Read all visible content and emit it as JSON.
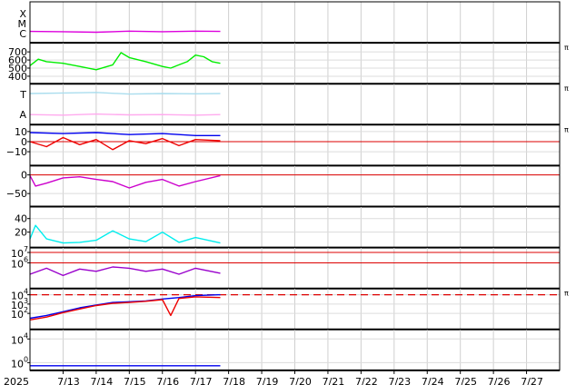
{
  "chart_data": {
    "type": "line",
    "x_start": "2025-07-12",
    "x_end": "2025-07-28",
    "x_ticks": [
      {
        "date": "2025-07-13",
        "label": "7/13"
      },
      {
        "date": "2025-07-14",
        "label": "7/14"
      },
      {
        "date": "2025-07-15",
        "label": "7/15"
      },
      {
        "date": "2025-07-16",
        "label": "7/16"
      },
      {
        "date": "2025-07-17",
        "label": "7/17"
      },
      {
        "date": "2025-07-18",
        "label": "7/18"
      },
      {
        "date": "2025-07-19",
        "label": "7/19"
      },
      {
        "date": "2025-07-20",
        "label": "7/20"
      },
      {
        "date": "2025-07-21",
        "label": "7/21"
      },
      {
        "date": "2025-07-22",
        "label": "7/22"
      },
      {
        "date": "2025-07-23",
        "label": "7/23"
      },
      {
        "date": "2025-07-24",
        "label": "7/24"
      },
      {
        "date": "2025-07-25",
        "label": "7/25"
      },
      {
        "date": "2025-07-26",
        "label": "7/26"
      },
      {
        "date": "2025-07-27",
        "label": "7/27"
      }
    ],
    "year_label": "2025",
    "data_end": "2025-07-17T18:00",
    "grid": true,
    "panels": [
      {
        "id": "xray-class",
        "yscale": "category",
        "categories": [
          "X",
          "M",
          "C"
        ],
        "series": [
          {
            "color": "#dd00dd",
            "level": "C",
            "points": [
              [
                "2025-07-12",
                0.1
              ],
              [
                "2025-07-13",
                0.15
              ],
              [
                "2025-07-14",
                0.25
              ],
              [
                "2025-07-15",
                0.05
              ],
              [
                "2025-07-16",
                0.15
              ],
              [
                "2025-07-17",
                0.05
              ],
              [
                "2025-07-17T18:00",
                0.1
              ]
            ]
          }
        ],
        "right_marker": ""
      },
      {
        "id": "solar-wind-speed",
        "yscale": "linear",
        "ylim": [
          330,
          790
        ],
        "ticks": [
          {
            "v": 400,
            "label": "400"
          },
          {
            "v": 500,
            "label": "500"
          },
          {
            "v": 600,
            "label": "600"
          },
          {
            "v": 700,
            "label": "700"
          }
        ],
        "series": [
          {
            "color": "#00ee00",
            "points": [
              [
                "2025-07-12",
                530
              ],
              [
                "2025-07-12T06:00",
                610
              ],
              [
                "2025-07-12T12:00",
                580
              ],
              [
                "2025-07-13",
                560
              ],
              [
                "2025-07-13T12:00",
                520
              ],
              [
                "2025-07-14",
                480
              ],
              [
                "2025-07-14T12:00",
                540
              ],
              [
                "2025-07-14T18:00",
                690
              ],
              [
                "2025-07-15",
                630
              ],
              [
                "2025-07-15T12:00",
                580
              ],
              [
                "2025-07-16",
                520
              ],
              [
                "2025-07-16T06:00",
                500
              ],
              [
                "2025-07-16T12:00",
                540
              ],
              [
                "2025-07-16T18:00",
                580
              ],
              [
                "2025-07-17",
                660
              ],
              [
                "2025-07-17T06:00",
                640
              ],
              [
                "2025-07-17T12:00",
                580
              ],
              [
                "2025-07-17T18:00",
                560
              ]
            ]
          }
        ],
        "right_marker": "π"
      },
      {
        "id": "imf-orientation",
        "yscale": "category",
        "categories": [
          "T",
          "A"
        ],
        "series": [
          {
            "color": "#ffaaee",
            "level": "A",
            "points": [
              [
                "2025-07-12",
                0.5
              ],
              [
                "2025-07-13",
                0.6
              ],
              [
                "2025-07-14",
                0.4
              ],
              [
                "2025-07-15",
                0.55
              ],
              [
                "2025-07-16",
                0.5
              ],
              [
                "2025-07-17",
                0.6
              ],
              [
                "2025-07-17T18:00",
                0.5
              ]
            ]
          },
          {
            "color": "#aaddee",
            "level": "T",
            "points": [
              [
                "2025-07-12",
                0.3
              ],
              [
                "2025-07-13",
                0.2
              ],
              [
                "2025-07-14",
                0.1
              ],
              [
                "2025-07-15",
                0.4
              ],
              [
                "2025-07-16",
                0.3
              ],
              [
                "2025-07-17",
                0.35
              ],
              [
                "2025-07-17T18:00",
                0.3
              ]
            ]
          }
        ],
        "right_marker": "π"
      },
      {
        "id": "imf-bt-bz",
        "yscale": "linear",
        "ylim": [
          -22,
          15
        ],
        "ticks": [
          {
            "v": -10,
            "label": "−10"
          },
          {
            "v": 0,
            "label": "0"
          },
          {
            "v": 10,
            "label": "10"
          }
        ],
        "ref_lines": [
          {
            "v": 0,
            "color": "#dd0000",
            "dash": false
          }
        ],
        "series": [
          {
            "color": "#0000ee",
            "points": [
              [
                "2025-07-12",
                9
              ],
              [
                "2025-07-13",
                8
              ],
              [
                "2025-07-14",
                9
              ],
              [
                "2025-07-15",
                7
              ],
              [
                "2025-07-16",
                8
              ],
              [
                "2025-07-17",
                6
              ],
              [
                "2025-07-17T18:00",
                6
              ]
            ]
          },
          {
            "color": "#ee0000",
            "points": [
              [
                "2025-07-12",
                0
              ],
              [
                "2025-07-12T12:00",
                -5
              ],
              [
                "2025-07-13",
                4
              ],
              [
                "2025-07-13T12:00",
                -3
              ],
              [
                "2025-07-14",
                2
              ],
              [
                "2025-07-14T12:00",
                -8
              ],
              [
                "2025-07-15",
                1
              ],
              [
                "2025-07-15T12:00",
                -2
              ],
              [
                "2025-07-16",
                3
              ],
              [
                "2025-07-16T12:00",
                -4
              ],
              [
                "2025-07-17",
                2
              ],
              [
                "2025-07-17T18:00",
                1
              ]
            ]
          }
        ],
        "right_marker": "π"
      },
      {
        "id": "dst-index",
        "yscale": "linear",
        "ylim": [
          -80,
          20
        ],
        "ticks": [
          {
            "v": -50,
            "label": "−50"
          },
          {
            "v": 0,
            "label": "0"
          }
        ],
        "ref_lines": [
          {
            "v": 0,
            "color": "#dd0000",
            "dash": false
          }
        ],
        "series": [
          {
            "color": "#cc00cc",
            "points": [
              [
                "2025-07-12",
                -2
              ],
              [
                "2025-07-12T04:00",
                -30
              ],
              [
                "2025-07-12T12:00",
                -22
              ],
              [
                "2025-07-13",
                -8
              ],
              [
                "2025-07-13T12:00",
                -5
              ],
              [
                "2025-07-14",
                -12
              ],
              [
                "2025-07-14T12:00",
                -18
              ],
              [
                "2025-07-15",
                -35
              ],
              [
                "2025-07-15T12:00",
                -20
              ],
              [
                "2025-07-16",
                -12
              ],
              [
                "2025-07-16T12:00",
                -30
              ],
              [
                "2025-07-17",
                -18
              ],
              [
                "2025-07-17T18:00",
                -2
              ]
            ]
          }
        ],
        "right_marker": ""
      },
      {
        "id": "kp-index",
        "yscale": "linear",
        "ylim": [
          0,
          55
        ],
        "ticks": [
          {
            "v": 20,
            "label": "20"
          },
          {
            "v": 40,
            "label": "40"
          }
        ],
        "series": [
          {
            "color": "#00eeee",
            "points": [
              [
                "2025-07-12",
                10
              ],
              [
                "2025-07-12T04:00",
                30
              ],
              [
                "2025-07-12T12:00",
                10
              ],
              [
                "2025-07-13",
                4
              ],
              [
                "2025-07-13T12:00",
                5
              ],
              [
                "2025-07-14",
                8
              ],
              [
                "2025-07-14T12:00",
                22
              ],
              [
                "2025-07-15",
                10
              ],
              [
                "2025-07-15T12:00",
                6
              ],
              [
                "2025-07-16",
                20
              ],
              [
                "2025-07-16T12:00",
                5
              ],
              [
                "2025-07-17",
                12
              ],
              [
                "2025-07-17T18:00",
                4
              ]
            ]
          }
        ],
        "right_marker": ""
      },
      {
        "id": "proton-flux",
        "yscale": "log",
        "ylim": [
          5000,
          20000000
        ],
        "ticks": [
          {
            "v": 1000000,
            "base": "10",
            "exp": "6"
          },
          {
            "v": 10000000,
            "base": "10",
            "exp": "7"
          }
        ],
        "ref_lines": [
          {
            "v": 1000000,
            "color": "#dd0000",
            "dash": false
          },
          {
            "v": 10000000,
            "color": "#dd0000",
            "dash": false
          }
        ],
        "series": [
          {
            "color": "#9900cc",
            "points": [
              [
                "2025-07-12",
                80000
              ],
              [
                "2025-07-12T12:00",
                300000
              ],
              [
                "2025-07-13",
                60000
              ],
              [
                "2025-07-13T12:00",
                250000
              ],
              [
                "2025-07-14",
                150000
              ],
              [
                "2025-07-14T12:00",
                400000
              ],
              [
                "2025-07-15",
                300000
              ],
              [
                "2025-07-15T12:00",
                150000
              ],
              [
                "2025-07-16",
                250000
              ],
              [
                "2025-07-16T12:00",
                80000
              ],
              [
                "2025-07-17",
                300000
              ],
              [
                "2025-07-17T18:00",
                100000
              ]
            ]
          }
        ],
        "right_marker": ""
      },
      {
        "id": "electron-flux",
        "yscale": "log",
        "ylim": [
          3,
          30000
        ],
        "ticks": [
          {
            "v": 100,
            "base": "10",
            "exp": "2"
          },
          {
            "v": 1000,
            "base": "10",
            "exp": "3"
          },
          {
            "v": 10000,
            "base": "10",
            "exp": "4"
          }
        ],
        "ref_lines": [
          {
            "v": 10000,
            "color": "#dd0000",
            "dash": true
          }
        ],
        "series": [
          {
            "color": "#0000ee",
            "points": [
              [
                "2025-07-12",
                30
              ],
              [
                "2025-07-12T12:00",
                60
              ],
              [
                "2025-07-13",
                150
              ],
              [
                "2025-07-13T12:00",
                400
              ],
              [
                "2025-07-14",
                800
              ],
              [
                "2025-07-14T12:00",
                1500
              ],
              [
                "2025-07-15",
                1800
              ],
              [
                "2025-07-15T12:00",
                2200
              ],
              [
                "2025-07-16",
                3500
              ],
              [
                "2025-07-16T12:00",
                5000
              ],
              [
                "2025-07-17",
                8000
              ],
              [
                "2025-07-17T18:00",
                10000
              ]
            ]
          },
          {
            "color": "#ee0000",
            "points": [
              [
                "2025-07-12",
                20
              ],
              [
                "2025-07-12T12:00",
                40
              ],
              [
                "2025-07-13",
                120
              ],
              [
                "2025-07-13T12:00",
                300
              ],
              [
                "2025-07-14",
                700
              ],
              [
                "2025-07-14T12:00",
                1200
              ],
              [
                "2025-07-15",
                1500
              ],
              [
                "2025-07-15T12:00",
                2000
              ],
              [
                "2025-07-16",
                3000
              ],
              [
                "2025-07-16T06:00",
                60
              ],
              [
                "2025-07-16T12:00",
                4000
              ],
              [
                "2025-07-17",
                6000
              ],
              [
                "2025-07-17T18:00",
                5000
              ]
            ]
          }
        ],
        "right_marker": "π"
      },
      {
        "id": "neutron-count",
        "yscale": "log",
        "ylim": [
          0.1,
          200000
        ],
        "ticks": [
          {
            "v": 1,
            "base": "10",
            "exp": "0"
          },
          {
            "v": 10000,
            "base": "10",
            "exp": "4"
          }
        ],
        "series": [
          {
            "color": "#0000ee",
            "points": [
              [
                "2025-07-12",
                0.3
              ],
              [
                "2025-07-13",
                0.3
              ],
              [
                "2025-07-14",
                0.3
              ],
              [
                "2025-07-15",
                0.3
              ],
              [
                "2025-07-16",
                0.3
              ],
              [
                "2025-07-17",
                0.3
              ],
              [
                "2025-07-17T18:00",
                0.3
              ]
            ]
          }
        ],
        "right_marker": ""
      }
    ]
  }
}
